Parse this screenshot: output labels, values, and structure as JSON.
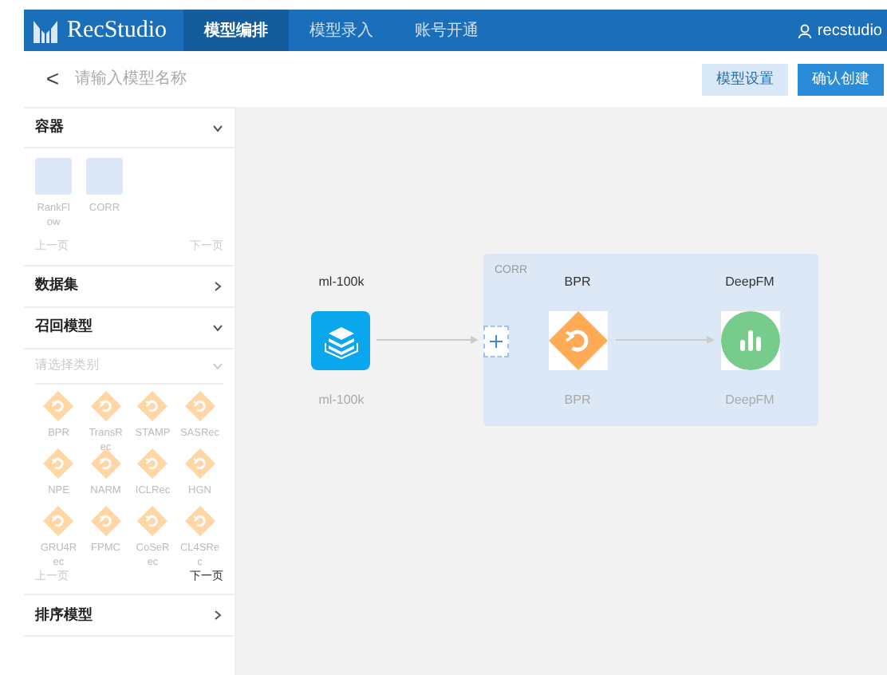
{
  "header": {
    "brand": "RecStudio",
    "tabs": [
      {
        "label": "模型编排",
        "selected": true
      },
      {
        "label": "模型录入",
        "selected": false
      },
      {
        "label": "账号开通",
        "selected": false
      }
    ],
    "user": "recstudio"
  },
  "toolbar": {
    "back": "<",
    "name_field": {
      "placeholder": "请输入模型名称"
    },
    "buttons": [
      {
        "label": "模型设置",
        "kind": "secondary"
      },
      {
        "label": "确认创建",
        "kind": "primary"
      }
    ]
  },
  "sidebar": {
    "sections": [
      {
        "title": "容器",
        "expanded": true,
        "kind": "containers",
        "items": [
          {
            "label": "RankFl\now"
          },
          {
            "label": "CORR"
          }
        ],
        "prev": "上一页",
        "next": "下一页",
        "next_enabled": false
      },
      {
        "title": "数据集",
        "expanded": false
      },
      {
        "title": "召回模型",
        "expanded": true,
        "kind": "models",
        "filter": {
          "placeholder": "请选择类别"
        },
        "items": [
          {
            "label": "BPR"
          },
          {
            "label": "TransR\nec"
          },
          {
            "label": "STAMP"
          },
          {
            "label": "SASRec"
          },
          {
            "label": "NPE"
          },
          {
            "label": "NARM"
          },
          {
            "label": "ICLRec"
          },
          {
            "label": "HGN"
          },
          {
            "label": "GRU4R\nec"
          },
          {
            "label": "FPMC"
          },
          {
            "label": "CoSeR\nec"
          },
          {
            "label": "CL4SRe\nc"
          }
        ],
        "prev": "上一页",
        "next": "下一页",
        "next_enabled": true
      },
      {
        "title": "排序模型",
        "expanded": false
      }
    ]
  },
  "canvas": {
    "dataset": {
      "top_label": "ml-100k",
      "bottom_label": "ml-100k"
    },
    "container": {
      "label": "CORR",
      "nodes": [
        {
          "kind": "recall",
          "top_label": "BPR",
          "bottom_label": "BPR"
        },
        {
          "kind": "rank",
          "top_label": "DeepFM",
          "bottom_label": "DeepFM"
        }
      ]
    }
  }
}
